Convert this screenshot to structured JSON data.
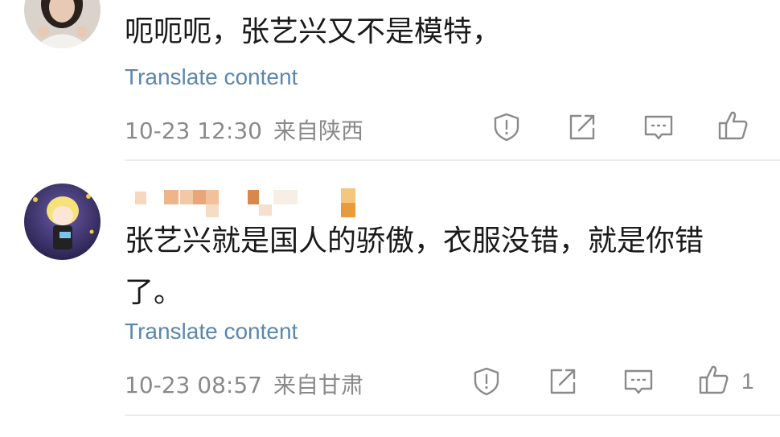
{
  "comments": [
    {
      "text": "呃呃呃，张艺兴又不是模特，",
      "translate_label": "Translate content",
      "date": "10-23 12:30",
      "location": "来自陕西",
      "like_count": ""
    },
    {
      "text_line1": "张艺兴就是国人的骄傲，衣服没错，就是你错",
      "text_line2": "了。",
      "translate_label": "Translate content",
      "date": "10-23 08:57",
      "location": "来自甘肃",
      "like_count": "1"
    }
  ],
  "icons": [
    "report-icon",
    "share-icon",
    "reply-icon",
    "like-icon"
  ],
  "colors": {
    "text": "#1a1a1a",
    "link": "#5b87ad",
    "meta": "#8a8a8a",
    "icon": "#8a8a8a",
    "divider": "#ececec"
  }
}
